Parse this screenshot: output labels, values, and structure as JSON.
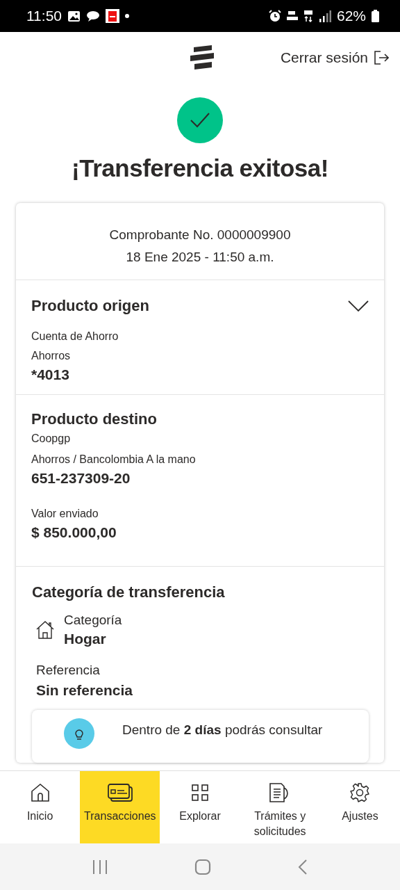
{
  "status_bar": {
    "time": "11:50",
    "battery": "62%"
  },
  "header": {
    "logout_label": "Cerrar sesión"
  },
  "title": "¡Transferencia exitosa!",
  "receipt": {
    "number": "Comprobante No. 0000009900",
    "date": "18 Ene 2025 - 11:50 a.m."
  },
  "origin": {
    "heading": "Producto origen",
    "product": "Cuenta de Ahorro",
    "type": "Ahorros",
    "account": "*4013"
  },
  "destination": {
    "heading": "Producto destino",
    "name": "Coopgp",
    "type": "Ahorros / Bancolombia A la mano",
    "account": "651-237309-20",
    "amount_label": "Valor enviado",
    "amount": "$ 850.000,00"
  },
  "category": {
    "heading": "Categoría de transferencia",
    "category_label": "Categoría",
    "category": "Hogar",
    "reference_label": "Referencia",
    "reference": "Sin referencia"
  },
  "tip": {
    "text": "Dentro de **2 días** podrás consultar"
  },
  "nav": [
    {
      "label": "Inicio",
      "selected": false
    },
    {
      "label": "Transacciones",
      "selected": true
    },
    {
      "label": "Explorar",
      "selected": false
    },
    {
      "label": "Trámites y solicitudes",
      "selected": false
    },
    {
      "label": "Ajustes",
      "selected": false
    }
  ]
}
